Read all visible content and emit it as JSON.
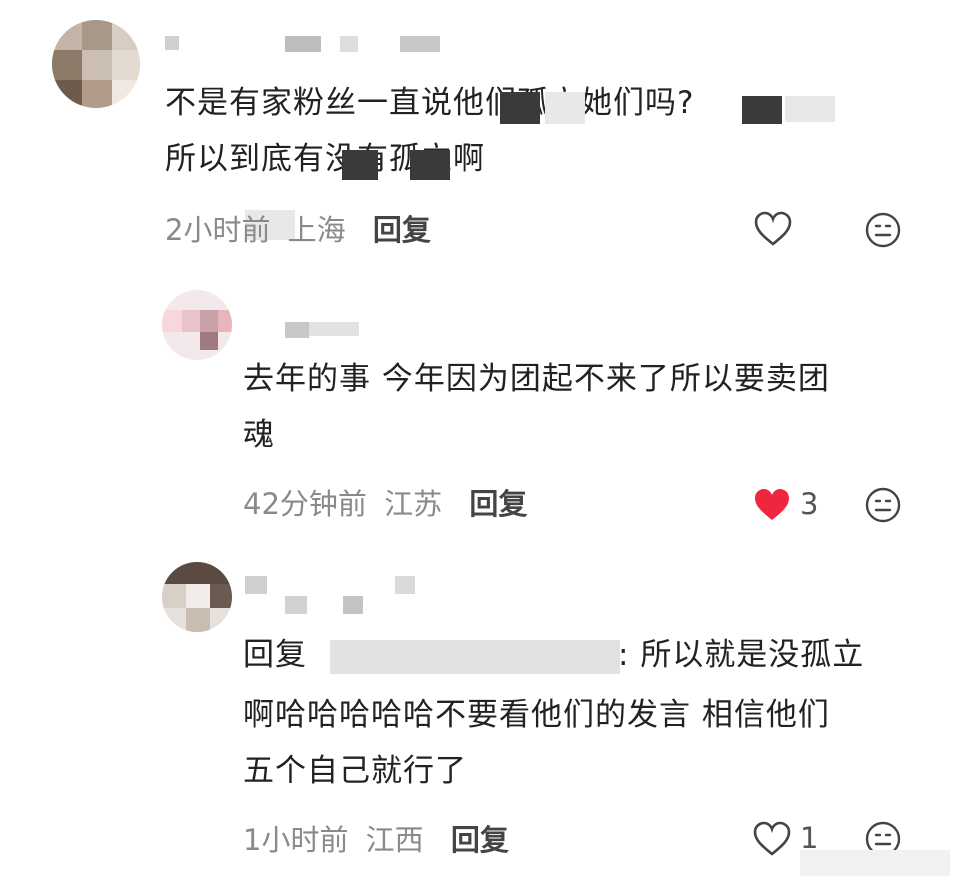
{
  "comments": [
    {
      "text_line1": "不是有家粉丝一直说他们孤立她们吗?",
      "text_line2": "所以到底有没有孤立啊",
      "time": "2小时前",
      "location": "上海",
      "reply_label": "回复",
      "liked": false,
      "like_count": ""
    },
    {
      "text_line1": "去年的事 今年因为团起不来了所以要卖团",
      "text_line2": "魂",
      "time": "42分钟前",
      "location": "江苏",
      "reply_label": "回复",
      "liked": true,
      "like_count": "3"
    },
    {
      "reply_prefix": "回复",
      "text_line1_rest": "所以就是没孤立",
      "text_line2": "啊哈哈哈哈哈不要看他们的发言 相信他们",
      "text_line3": "五个自己就行了",
      "time": "1小时前",
      "location": "江西",
      "reply_label": "回复",
      "liked": false,
      "like_count": "1"
    }
  ],
  "colors": {
    "like_red": "#f0263f",
    "meta_gray": "#8a8a8a"
  }
}
